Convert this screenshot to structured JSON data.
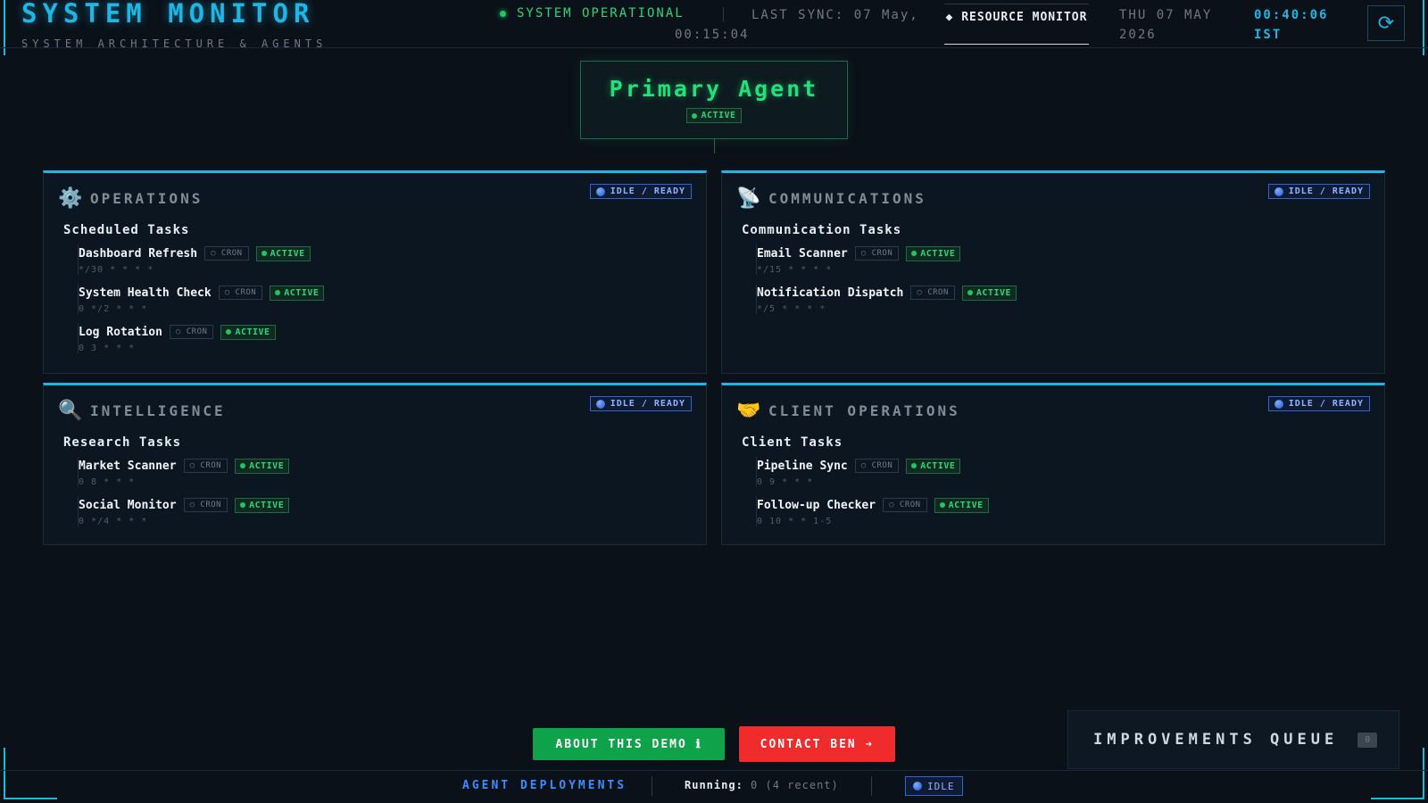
{
  "header": {
    "title": "SYSTEM MONITOR",
    "subtitle": "SYSTEM ARCHITECTURE & AGENTS",
    "status": "SYSTEM OPERATIONAL",
    "last_sync": "LAST SYNC: 07 May, 00:15:04",
    "resource_button": "◆ RESOURCE MONITOR",
    "date": "THU 07 MAY 2026",
    "clock": "00:40:06 IST",
    "refresh_icon": "⟳"
  },
  "primary_agent": {
    "title": "Primary Agent",
    "status": "ACTIVE"
  },
  "labels": {
    "cron": "○ CRON",
    "active": "ACTIVE",
    "idle_ready": "IDLE / READY"
  },
  "panels": [
    {
      "icon": "⚙️",
      "title": "OPERATIONS",
      "group": "Scheduled Tasks",
      "tasks": [
        {
          "name": "Dashboard Refresh",
          "schedule": "*/30 * * * *"
        },
        {
          "name": "System Health Check",
          "schedule": "0 */2 * * *"
        },
        {
          "name": "Log Rotation",
          "schedule": "0 3 * * *"
        }
      ]
    },
    {
      "icon": "📡",
      "title": "COMMUNICATIONS",
      "group": "Communication Tasks",
      "tasks": [
        {
          "name": "Email Scanner",
          "schedule": "*/15 * * * *"
        },
        {
          "name": "Notification Dispatch",
          "schedule": "*/5 * * * *"
        }
      ]
    },
    {
      "icon": "🔍",
      "title": "INTELLIGENCE",
      "group": "Research Tasks",
      "tasks": [
        {
          "name": "Market Scanner",
          "schedule": "0 8 * * *"
        },
        {
          "name": "Social Monitor",
          "schedule": "0 */4 * * *"
        }
      ]
    },
    {
      "icon": "🤝",
      "title": "CLIENT OPERATIONS",
      "group": "Client Tasks",
      "tasks": [
        {
          "name": "Pipeline Sync",
          "schedule": "0 9 * * *"
        },
        {
          "name": "Follow-up Checker",
          "schedule": "0 10 * * 1-5"
        }
      ]
    }
  ],
  "buttons": {
    "about": "ABOUT THIS DEMO ℹ",
    "contact": "CONTACT BEN ➔"
  },
  "improvements": {
    "title": "IMPROVEMENTS QUEUE",
    "count": "0"
  },
  "footer": {
    "title": "AGENT DEPLOYMENTS",
    "running_label": "Running:",
    "running_count": "0",
    "running_recent": "(4 recent)",
    "idle": "IDLE"
  },
  "colors": {
    "accent": "#1fb6e6",
    "active_green": "#22c55e",
    "idle_blue": "#2f63d8",
    "about_button": "#0ea34a",
    "contact_button": "#ef2b2b"
  }
}
